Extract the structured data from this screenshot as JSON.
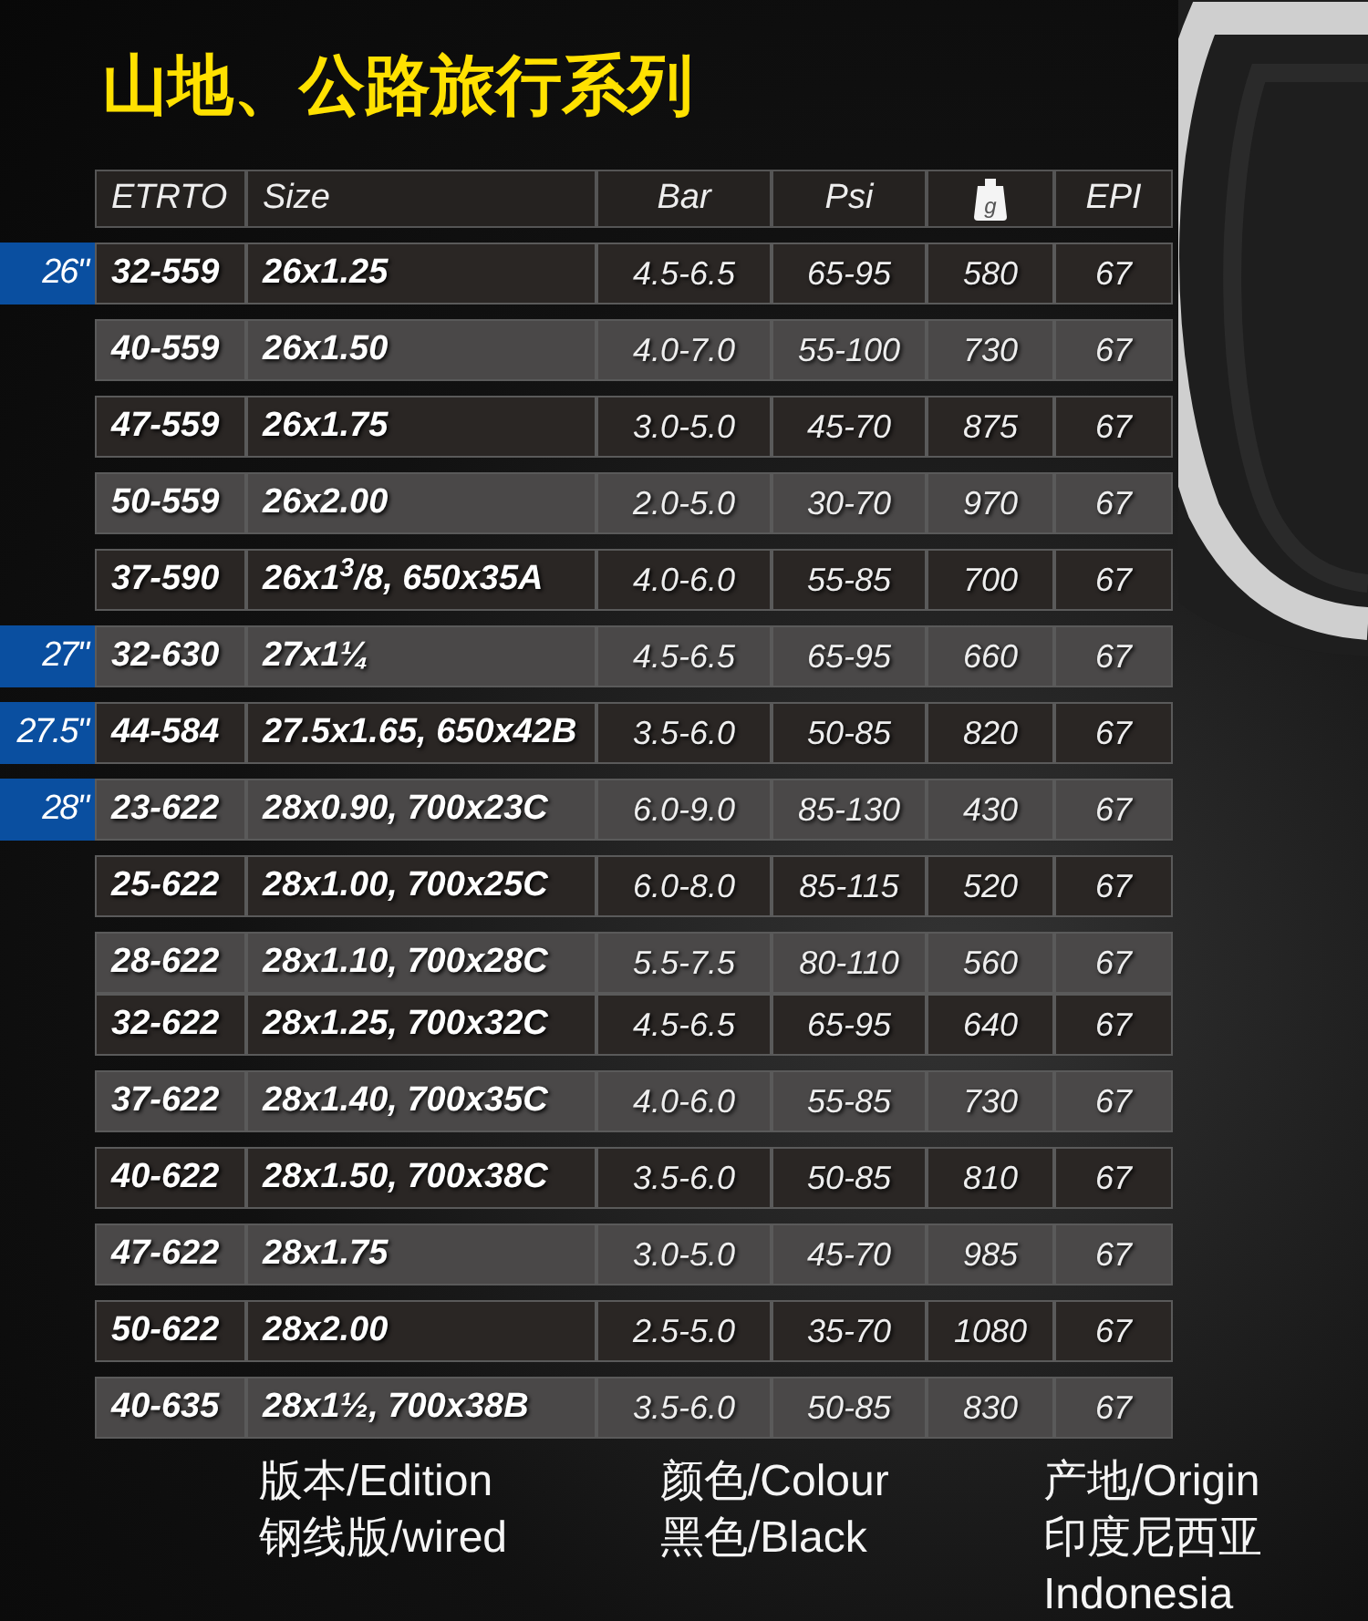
{
  "title": "山地、公路旅行系列",
  "columns": [
    "ETRTO",
    "Size",
    "Bar",
    "Psi",
    "g",
    "EPI"
  ],
  "rows": [
    {
      "group": "26\"",
      "etrto": "32-559",
      "size": "26x1.25",
      "bar": "4.5-6.5",
      "psi": "65-95",
      "weight": "580",
      "epi": "67",
      "color": "#2a2624",
      "joined": false
    },
    {
      "etrto": "40-559",
      "size": "26x1.50",
      "bar": "4.0-7.0",
      "psi": "55-100",
      "weight": "730",
      "epi": "67",
      "color": "#4a4848",
      "joined": false
    },
    {
      "etrto": "47-559",
      "size": "26x1.75",
      "bar": "3.0-5.0",
      "psi": "45-70",
      "weight": "875",
      "epi": "67",
      "color": "#2a2624",
      "joined": false
    },
    {
      "etrto": "50-559",
      "size": "26x2.00",
      "bar": "2.0-5.0",
      "psi": "30-70",
      "weight": "970",
      "epi": "67",
      "color": "#4a4848",
      "joined": false
    },
    {
      "etrto": "37-590",
      "size": "26x1$^{3}$/8, 650x35A",
      "bar": "4.0-6.0",
      "psi": "55-85",
      "weight": "700",
      "epi": "67",
      "color": "#2a2624",
      "joined": false
    },
    {
      "group": "27\"",
      "etrto": "32-630",
      "size": "27x1¼",
      "bar": "4.5-6.5",
      "psi": "65-95",
      "weight": "660",
      "epi": "67",
      "color": "#4a4848",
      "joined": false
    },
    {
      "group": "27.5\"",
      "etrto": "44-584",
      "size": "27.5x1.65, 650x42B",
      "bar": "3.5-6.0",
      "psi": "50-85",
      "weight": "820",
      "epi": "67",
      "color": "#2a2624",
      "joined": false
    },
    {
      "group": "28\"",
      "etrto": "23-622",
      "size": "28x0.90, 700x23C",
      "bar": "6.0-9.0",
      "psi": "85-130",
      "weight": "430",
      "epi": "67",
      "color": "#4a4848",
      "joined": false
    },
    {
      "etrto": "25-622",
      "size": "28x1.00, 700x25C",
      "bar": "6.0-8.0",
      "psi": "85-115",
      "weight": "520",
      "epi": "67",
      "color": "#2a2624",
      "joined": false
    },
    {
      "etrto": "28-622",
      "size": "28x1.10, 700x28C",
      "bar": "5.5-7.5",
      "psi": "80-110",
      "weight": "560",
      "epi": "67",
      "color": "#4a4848",
      "joined": false
    },
    {
      "etrto": "32-622",
      "size": "28x1.25, 700x32C",
      "bar": "4.5-6.5",
      "psi": "65-95",
      "weight": "640",
      "epi": "67",
      "color": "#2a2624",
      "joined": true
    },
    {
      "etrto": "37-622",
      "size": "28x1.40, 700x35C",
      "bar": "4.0-6.0",
      "psi": "55-85",
      "weight": "730",
      "epi": "67",
      "color": "#4a4848",
      "joined": false
    },
    {
      "etrto": "40-622",
      "size": "28x1.50, 700x38C",
      "bar": "3.5-6.0",
      "psi": "50-85",
      "weight": "810",
      "epi": "67",
      "color": "#2a2624",
      "joined": false
    },
    {
      "etrto": "47-622",
      "size": "28x1.75",
      "bar": "3.0-5.0",
      "psi": "45-70",
      "weight": "985",
      "epi": "67",
      "color": "#4a4848",
      "joined": false
    },
    {
      "etrto": "50-622",
      "size": "28x2.00",
      "bar": "2.5-5.0",
      "psi": "35-70",
      "weight": "1080",
      "epi": "67",
      "color": "#2a2624",
      "joined": false
    },
    {
      "etrto": "40-635",
      "size": "28x1½, 700x38B",
      "bar": "3.5-6.0",
      "psi": "50-85",
      "weight": "830",
      "epi": "67",
      "color": "#4a4848",
      "joined": false
    }
  ],
  "footer": [
    [
      "版本/Edition",
      "钢线版/wired"
    ],
    [
      "颜色/Colour",
      "黑色/Black"
    ],
    [
      "产地/Origin",
      "印度尼西亚",
      "Indonesia"
    ]
  ]
}
